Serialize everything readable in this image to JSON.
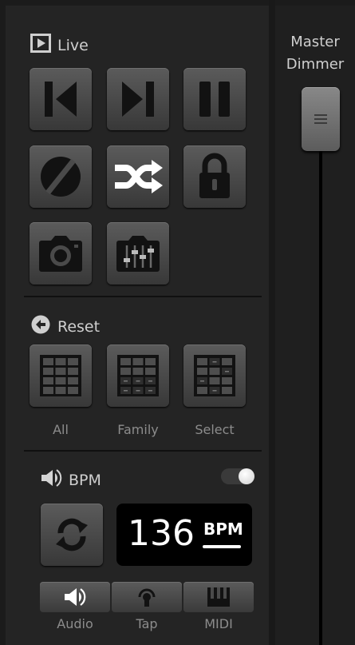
{
  "live": {
    "label": "Live"
  },
  "reset": {
    "label": "Reset",
    "buttons": [
      {
        "label": "All"
      },
      {
        "label": "Family"
      },
      {
        "label": "Select"
      }
    ]
  },
  "bpm": {
    "label": "BPM",
    "value": "136",
    "unit": "BPM",
    "sources": [
      {
        "label": "Audio"
      },
      {
        "label": "Tap"
      },
      {
        "label": "MIDI"
      }
    ]
  },
  "master": {
    "title_line1": "Master",
    "title_line2": "Dimmer"
  }
}
